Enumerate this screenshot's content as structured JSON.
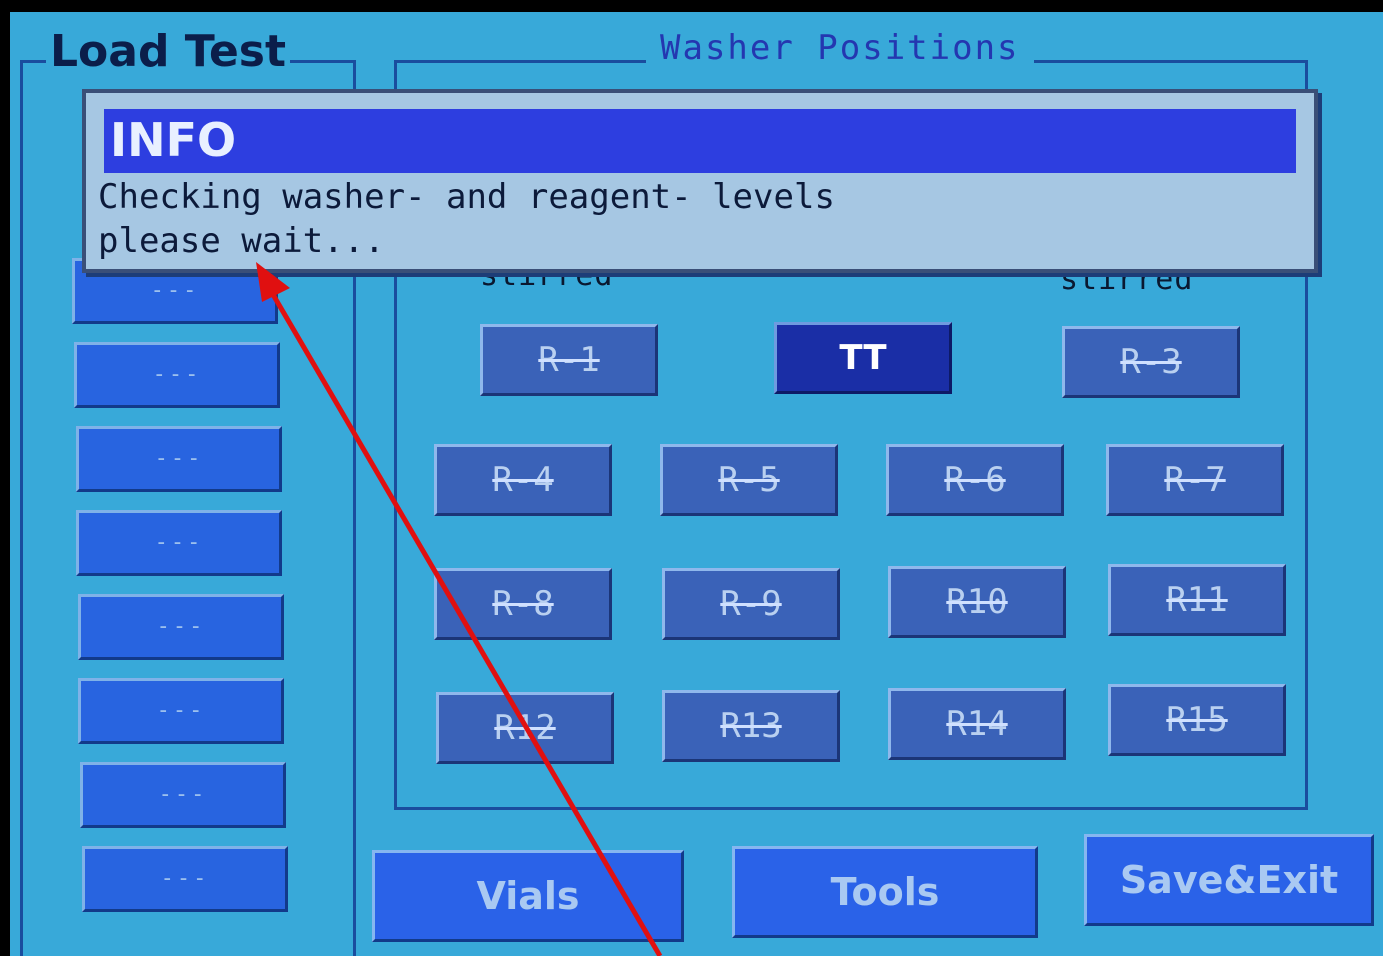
{
  "screen": {
    "title": "Load Test",
    "washer_positions_title": "Washer Positions"
  },
  "left_list": [
    "---",
    "---",
    "---",
    "---",
    "---",
    "---",
    "---",
    "---"
  ],
  "stirred_left": "stirred",
  "stirred_right": "stirred",
  "positions": {
    "row1": [
      "R-1",
      "TT",
      "R-3"
    ],
    "row2": [
      "R-4",
      "R-5",
      "R-6",
      "R-7"
    ],
    "row3": [
      "R-8",
      "R-9",
      "R10",
      "R11"
    ],
    "row4": [
      "R12",
      "R13",
      "R14",
      "R15"
    ]
  },
  "bottom_buttons": {
    "vials": "Vials",
    "tools": "Tools",
    "save_exit": "Save&Exit"
  },
  "dialog": {
    "title": "INFO",
    "line1": "Checking washer- and reagent- levels",
    "line2": "please wait..."
  },
  "colors": {
    "screen_bg": "#38a9d9",
    "dialog_title_bg": "#2d3ee0",
    "annotation_arrow": "#e01010"
  }
}
